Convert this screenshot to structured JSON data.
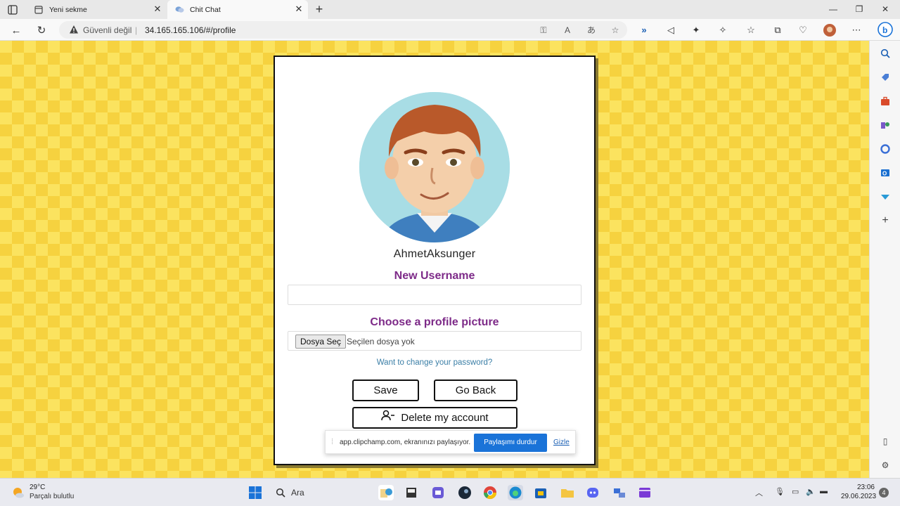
{
  "browser": {
    "tabs": [
      {
        "title": "Yeni sekme",
        "active": false
      },
      {
        "title": "Chit Chat",
        "active": true
      }
    ],
    "address": {
      "security_label": "Güvenli değil",
      "url": "34.165.165.106/#/profile"
    }
  },
  "profile": {
    "username": "AhmetAksunger",
    "new_username_title": "New Username",
    "new_username_value": "",
    "picture_title": "Choose a profile picture",
    "file_button_label": "Dosya Seç",
    "file_status": "Seçilen dosya yok",
    "change_password_link": "Want to change your password?",
    "save_label": "Save",
    "go_back_label": "Go Back",
    "delete_label": "Delete my account"
  },
  "share_bar": {
    "message": "app.clipchamp.com, ekranınızı paylaşıyor.",
    "stop_label": "Paylaşımı durdur",
    "hide_label": "Gizle"
  },
  "taskbar": {
    "temperature": "29°C",
    "weather_desc": "Parçalı bulutlu",
    "search_label": "Ara",
    "time": "23:06",
    "date": "29.06.2023",
    "notification_count": "4"
  }
}
